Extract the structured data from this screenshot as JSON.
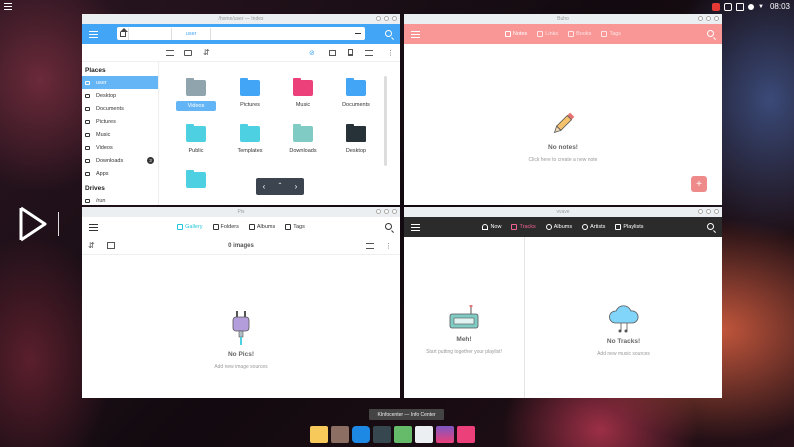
{
  "topbar": {
    "clock": "08:03"
  },
  "colors": {
    "index_blue": "#42a5f5",
    "buho_pink": "#f99696",
    "vvave_dark": "#2b2b2b",
    "pix_accent": "#26c6da",
    "vvave_accent": "#f06292"
  },
  "index": {
    "title": "/home/user — Index",
    "breadcrumb": [
      "home",
      "user"
    ],
    "sidebar": {
      "places_title": "Places",
      "places": [
        {
          "label": "user",
          "icon": "home-icon"
        },
        {
          "label": "Desktop",
          "icon": "desktop-icon"
        },
        {
          "label": "Documents",
          "icon": "folder-icon"
        },
        {
          "label": "Pictures",
          "icon": "folder-icon"
        },
        {
          "label": "Music",
          "icon": "music-icon"
        },
        {
          "label": "Videos",
          "icon": "video-icon"
        },
        {
          "label": "Downloads",
          "icon": "download-icon",
          "badge": "3"
        },
        {
          "label": "Apps",
          "icon": "apps-icon"
        }
      ],
      "drives_title": "Drives",
      "drives": [
        {
          "label": "/run",
          "icon": "drive-icon"
        }
      ]
    },
    "folders": [
      {
        "label": "Videos",
        "color": "#90a4ae"
      },
      {
        "label": "Pictures",
        "color": "#42a5f5"
      },
      {
        "label": "Music",
        "color": "#ec407a"
      },
      {
        "label": "Documents",
        "color": "#42a5f5"
      },
      {
        "label": "Public",
        "color": "#4dd0e1"
      },
      {
        "label": "Templates",
        "color": "#4dd0e1"
      },
      {
        "label": "Downloads",
        "color": "#80cbc4"
      },
      {
        "label": "Desktop",
        "color": "#263238"
      },
      {
        "label": "",
        "color": "#4dd0e1"
      }
    ]
  },
  "buho": {
    "title": "Buho",
    "tabs": [
      "Notes",
      "Links",
      "Books",
      "Tags"
    ],
    "empty_title": "No notes!",
    "empty_sub": "Click here to create a new note",
    "fab": "+"
  },
  "pix": {
    "title": "Pix",
    "tabs": [
      "Gallery",
      "Folders",
      "Albums",
      "Tags"
    ],
    "count": "0 images",
    "empty_title": "No Pics!",
    "empty_sub": "Add new image sources"
  },
  "vvave": {
    "title": "vvave",
    "tabs": [
      "Now",
      "Tracks",
      "Albums",
      "Artists",
      "Playlists"
    ],
    "left_title": "Meh!",
    "left_sub": "Start putting together your playlist!",
    "right_title": "No Tracks!",
    "right_sub": "Add new music sources"
  },
  "taskbar": {
    "tooltip": "KInfocenter — Info Center"
  }
}
